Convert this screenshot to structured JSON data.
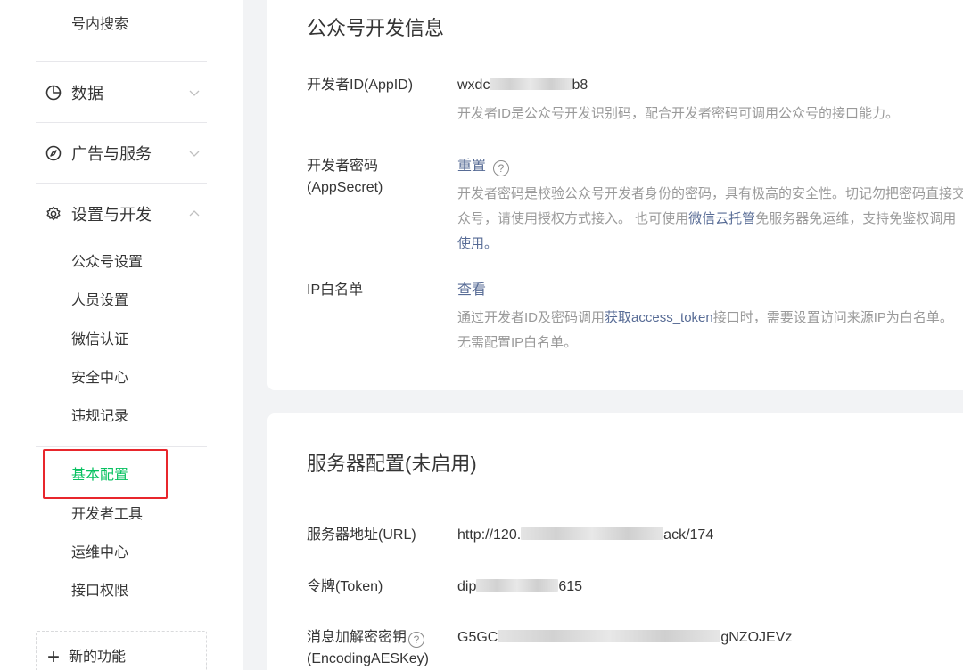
{
  "sidebar": {
    "top_item": "号内搜索",
    "sections": [
      {
        "label": "数据",
        "icon": "pie-chart-icon",
        "expanded": false
      },
      {
        "label": "广告与服务",
        "icon": "compass-icon",
        "expanded": false
      },
      {
        "label": "设置与开发",
        "icon": "gear-icon",
        "expanded": true
      }
    ],
    "settings_items": [
      "公众号设置",
      "人员设置",
      "微信认证",
      "安全中心",
      "违规记录"
    ],
    "dev_items": [
      "基本配置",
      "开发者工具",
      "运维中心",
      "接口权限"
    ],
    "active_item": "基本配置",
    "new_feature": "新的功能",
    "colors": {
      "active": "#07c160",
      "highlight": "#e8262c"
    }
  },
  "developer_info": {
    "title": "公众号开发信息",
    "appid": {
      "label": "开发者ID(AppID)",
      "value_prefix": "wxdc",
      "value_suffix": "b8",
      "desc": "开发者ID是公众号开发识别码，配合开发者密码可调用公众号的接口能力。"
    },
    "appsecret": {
      "label": "开发者密码(AppSecret)",
      "action": "重置",
      "desc_1": "开发者密码是校验公众号开发者身份的密码，具有极高的安全性。切记勿把密码直接交",
      "desc_2a": "众号，请使用授权方式接入。 也可使用",
      "desc_link": "微信云托管",
      "desc_2b": "免服务器免运维，支持免鉴权调用",
      "desc_3": "使用。"
    },
    "ip_whitelist": {
      "label": "IP白名单",
      "action": "查看",
      "desc_1a": "通过开发者ID及密码调用",
      "desc_link": "获取access_token",
      "desc_1b": "接口时，需要设置访问来源IP为白名单。",
      "desc_2": "无需配置IP白名单。"
    }
  },
  "server_config": {
    "title": "服务器配置(未启用)",
    "url": {
      "label": "服务器地址(URL)",
      "value_prefix": "http://120.",
      "value_suffix": "ack/174"
    },
    "token": {
      "label": "令牌(Token)",
      "value_prefix": "dip",
      "value_suffix": "615"
    },
    "aeskey": {
      "label_1": "消息加解密密钥",
      "label_2": "(EncodingAESKey)",
      "value_prefix": "G5GC",
      "value_suffix": "gNZOJEVz"
    }
  },
  "colors": {
    "link": "#576b95",
    "muted": "#9a9a9a",
    "page_bg": "#f2f3f5"
  }
}
